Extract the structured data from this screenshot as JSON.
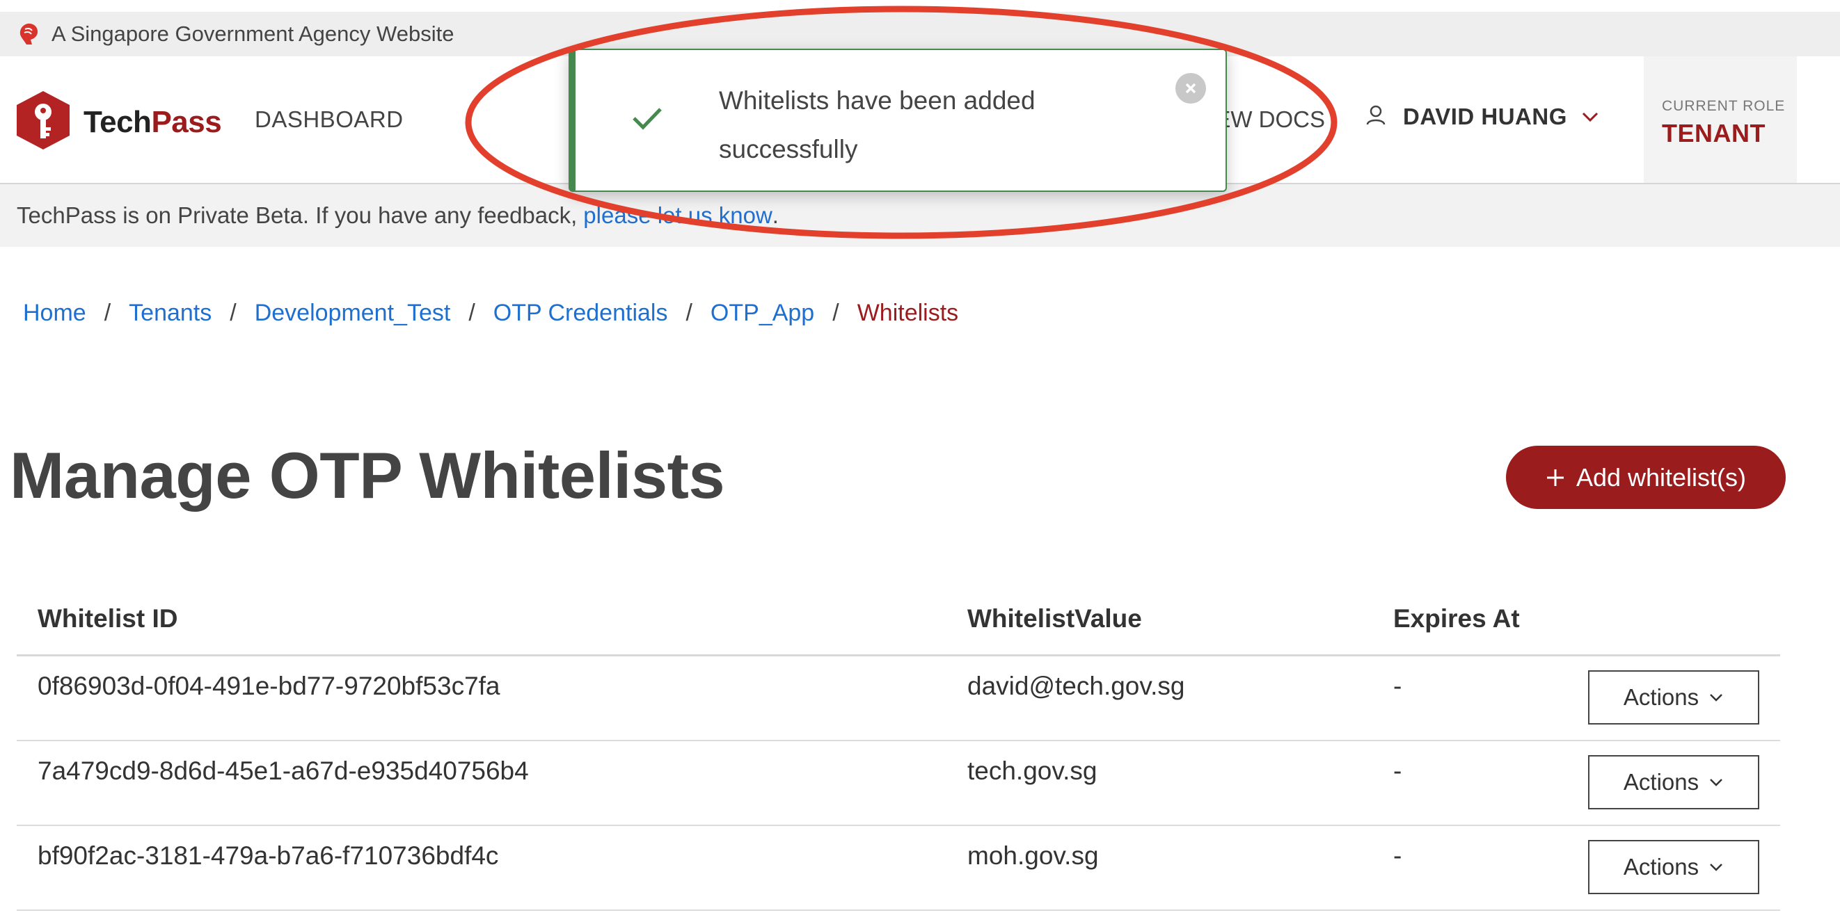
{
  "gov_bar": {
    "text": "A Singapore Government Agency Website",
    "icon": "lion-head-icon"
  },
  "header": {
    "logo": {
      "part1": "Tech",
      "part2": "Pass",
      "icon": "key-shield-icon"
    },
    "nav": {
      "dashboard": "DASHBOARD",
      "docs": "VIEW DOCS"
    },
    "user": {
      "name": "DAVID HUANG",
      "icon": "user-icon"
    },
    "role": {
      "label": "CURRENT ROLE",
      "value": "TENANT"
    }
  },
  "beta": {
    "text": "TechPass is on Private Beta. If you have any feedback,",
    "link": "please let us know",
    "end": "."
  },
  "toast": {
    "message": "Whitelists have been added successfully",
    "icon": "check-icon"
  },
  "breadcrumb": {
    "items": [
      "Home",
      "Tenants",
      "Development_Test",
      "OTP Credentials",
      "OTP_App"
    ],
    "current": "Whitelists",
    "separator": "/"
  },
  "page": {
    "title": "Manage OTP Whitelists",
    "add_button": "Add whitelist(s)"
  },
  "table": {
    "headers": {
      "id": "Whitelist ID",
      "value": "WhitelistValue",
      "expires": "Expires At"
    },
    "rows": [
      {
        "id": "0f86903d-0f04-491e-bd77-9720bf53c7fa",
        "value": "david@tech.gov.sg",
        "expires": "-",
        "action": "Actions"
      },
      {
        "id": "7a479cd9-8d6d-45e1-a67d-e935d40756b4",
        "value": "tech.gov.sg",
        "expires": "-",
        "action": "Actions"
      },
      {
        "id": "bf90f2ac-3181-479a-b7a6-f710736bdf4c",
        "value": "moh.gov.sg",
        "expires": "-",
        "action": "Actions"
      }
    ]
  },
  "colors": {
    "brand": "#9b1c1c",
    "link": "#1f6fd0",
    "success": "#46894f",
    "annotation": "#e2402c"
  }
}
